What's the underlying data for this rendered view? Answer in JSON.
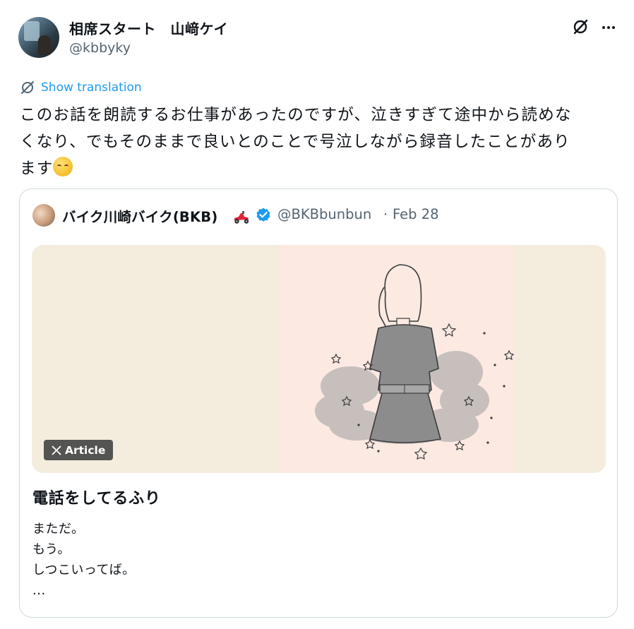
{
  "tweet": {
    "display_name": "相席スタート　山﨑ケイ",
    "handle": "@kbbyky",
    "show_translation": "Show translation",
    "text_lines": [
      "このお話を朗読するお仕事があったのですが、泣きすぎて途中から読めな",
      "くなり、でもそのままで良いとのことで号泣しながら録音したことがあり",
      "ます"
    ],
    "emoji": "relieved-face"
  },
  "quote": {
    "display_name": "バイク川崎バイク(BKB)",
    "handle": "@BKBbunbun",
    "separator": "·",
    "date": "Feb 28",
    "article_badge": "Article",
    "article_title": "電話をしてるふり",
    "article_body": [
      "まただ。",
      "もう。",
      "しつこいってば。",
      "..."
    ]
  },
  "icons": {
    "grok": "grok-icon",
    "more": "more-icon",
    "translate": "translate-icon",
    "verified": "verified-badge-icon",
    "scooter": "scooter-emoji-icon",
    "x_logo": "x-logo-icon"
  },
  "colors": {
    "link": "#1d9bf0",
    "secondary_text": "#536471",
    "border": "#cfd9de",
    "image_background": "#f4eddd",
    "illustration_background": "#fbe9e2",
    "verified": "#1d9bf0"
  }
}
